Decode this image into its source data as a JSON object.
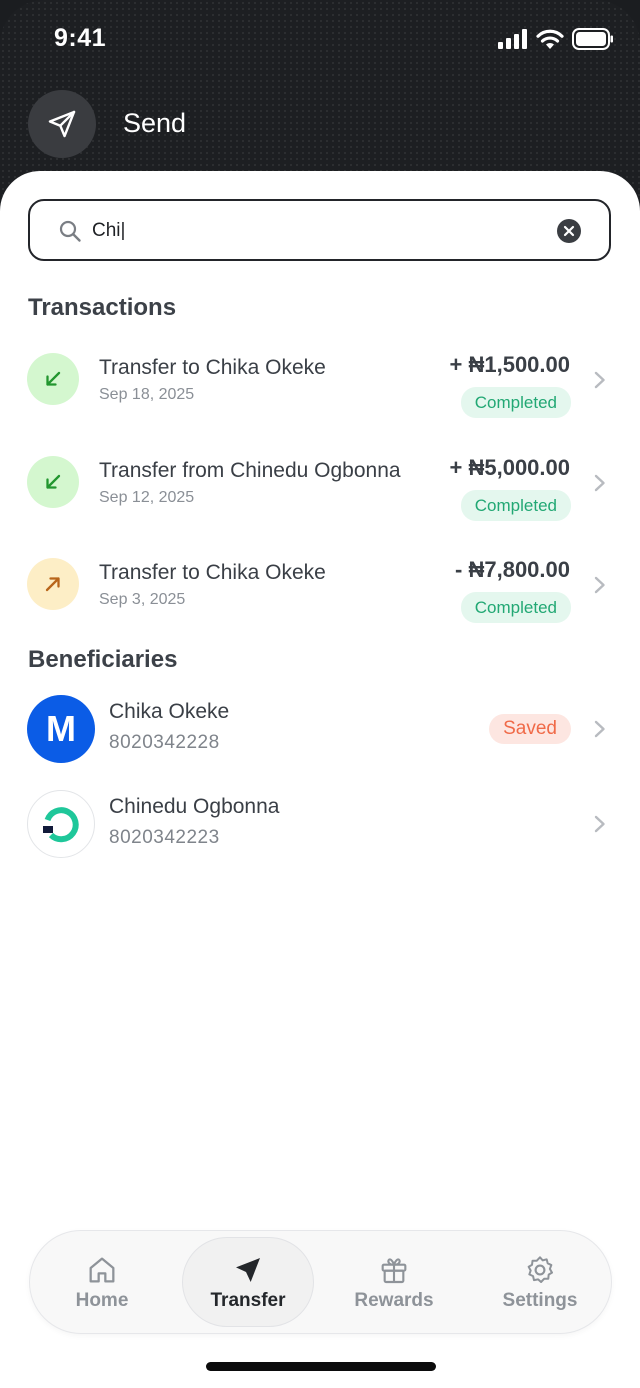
{
  "status_bar": {
    "time": "9:41"
  },
  "header": {
    "title": "Send",
    "icon": "paper-plane-icon"
  },
  "search": {
    "value": "Chi|",
    "icon": "search-icon",
    "clear_icon": "clear-icon"
  },
  "transactions": {
    "title": "Transactions",
    "items": [
      {
        "title": "Transfer to Chika Okeke",
        "date": "Sep 18, 2025",
        "amount": "+ ₦1,500.00",
        "status": "Completed",
        "direction": "in"
      },
      {
        "title": "Transfer from Chinedu Ogbonna",
        "date": "Sep 12, 2025",
        "amount": "+ ₦5,000.00",
        "status": "Completed",
        "direction": "in"
      },
      {
        "title": "Transfer to Chika Okeke",
        "date": "Sep 3, 2025",
        "amount": "- ₦7,800.00",
        "status": "Completed",
        "direction": "out"
      }
    ]
  },
  "beneficiaries": {
    "title": "Beneficiaries",
    "items": [
      {
        "name": "Chika Okeke",
        "account": "8020342228",
        "badge": "Saved",
        "avatar_letter": "M"
      },
      {
        "name": "Chinedu Ogbonna",
        "account": "8020342223"
      }
    ]
  },
  "tabbar": {
    "active": "Transfer",
    "items": [
      {
        "label": "Home",
        "icon": "home-icon"
      },
      {
        "label": "Transfer",
        "icon": "paper-plane-icon"
      },
      {
        "label": "Rewards",
        "icon": "gift-icon"
      },
      {
        "label": "Settings",
        "icon": "gear-icon"
      }
    ]
  },
  "colors": {
    "header_bg": "#1d1f22",
    "completed_bg": "#e4f7ee",
    "completed_text": "#22a874",
    "saved_bg": "#fde6e1",
    "saved_text": "#f06a48",
    "incoming_bg": "#d4f7cf",
    "outgoing_bg": "#fdeec6",
    "brand_blue": "#0b5ce6",
    "brand_green": "#1fc79a"
  }
}
